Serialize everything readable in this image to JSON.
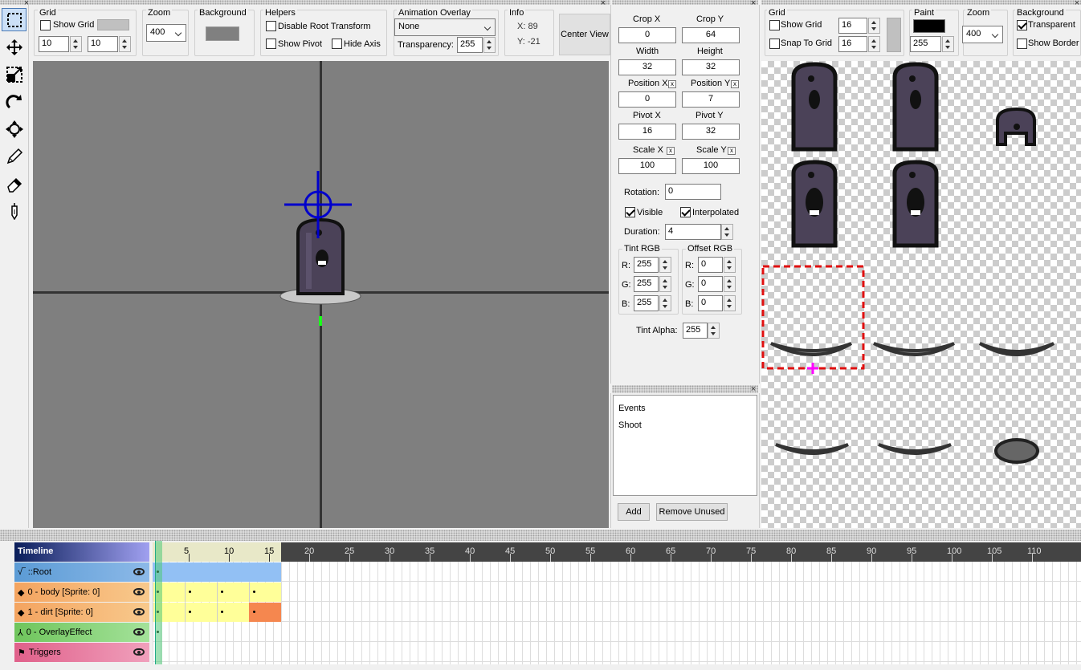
{
  "toolbar": {
    "grid": {
      "title": "Grid",
      "show_grid": "Show Grid",
      "w": "10",
      "h": "10"
    },
    "zoom": {
      "title": "Zoom",
      "value": "400"
    },
    "background": {
      "title": "Background",
      "color": "#808080"
    },
    "helpers": {
      "title": "Helpers",
      "disable_root": "Disable Root Transform",
      "show_pivot": "Show Pivot",
      "hide_axis": "Hide Axis"
    },
    "overlay": {
      "title": "Animation Overlay",
      "value": "None",
      "transparency_label": "Transparency:",
      "transparency": "255"
    },
    "info": {
      "title": "Info",
      "x": "X: 89",
      "y": "Y: -21"
    },
    "center_view": "Center View"
  },
  "tools": [
    "select-tool",
    "move-tool",
    "scale-tool",
    "rotate-tool",
    "pivot-tool",
    "draw-tool",
    "erase-tool",
    "crop-tool"
  ],
  "props": {
    "crop_x": {
      "label": "Crop X",
      "value": "0"
    },
    "crop_y": {
      "label": "Crop Y",
      "value": "64"
    },
    "width": {
      "label": "Width",
      "value": "32"
    },
    "height": {
      "label": "Height",
      "value": "32"
    },
    "pos_x": {
      "label": "Position X",
      "value": "0"
    },
    "pos_y": {
      "label": "Position Y",
      "value": "7"
    },
    "pivot_x": {
      "label": "Pivot X",
      "value": "16"
    },
    "pivot_y": {
      "label": "Pivot Y",
      "value": "32"
    },
    "scale_x": {
      "label": "Scale X",
      "value": "100"
    },
    "scale_y": {
      "label": "Scale Y",
      "value": "100"
    },
    "x_mark": "x",
    "rotation": {
      "label": "Rotation:",
      "value": "0"
    },
    "visible": "Visible",
    "interpolated": "Interpolated",
    "duration": {
      "label": "Duration:",
      "value": "4"
    },
    "tint": {
      "title": "Tint RGB",
      "r": "255",
      "g": "255",
      "b": "255"
    },
    "offset": {
      "title": "Offset RGB",
      "r": "0",
      "g": "0",
      "b": "0"
    },
    "r_label": "R:",
    "g_label": "G:",
    "b_label": "B:",
    "tint_alpha": {
      "label": "Tint Alpha:",
      "value": "255"
    }
  },
  "events": {
    "items": [
      "Events",
      "Shoot"
    ],
    "add": "Add",
    "remove_unused": "Remove Unused"
  },
  "sheet": {
    "grid_title": "Grid",
    "show_grid": "Show Grid",
    "snap_to_grid": "Snap To Grid",
    "gw": "16",
    "gh": "16",
    "paint_title": "Paint",
    "paint_color": "#000000",
    "paint_alpha": "255",
    "zoom_title": "Zoom",
    "zoom": "400",
    "bg_title": "Background",
    "transparent": "Transparent",
    "show_border": "Show Border"
  },
  "timeline": {
    "title": "Timeline",
    "ticks": [
      "5",
      "10",
      "15",
      "20",
      "25",
      "30",
      "35",
      "40",
      "45",
      "50",
      "55",
      "60",
      "65",
      "70",
      "75",
      "80",
      "85",
      "90",
      "95",
      "100",
      "105",
      "110"
    ],
    "rows": [
      {
        "label": "::Root",
        "color": "#5b9bd5"
      },
      {
        "label": "0 - body [Sprite: 0]",
        "color": "#f4a460"
      },
      {
        "label": "1 - dirt [Sprite: 0]",
        "color": "#f4a460"
      },
      {
        "label": "0 - OverlayEffect",
        "color": "#7ccc6a"
      },
      {
        "label": "Triggers",
        "color": "#e0608a"
      }
    ]
  }
}
